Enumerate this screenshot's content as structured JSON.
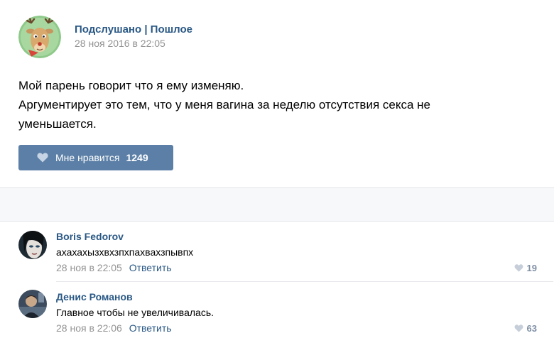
{
  "post": {
    "group_name": "Подслушано | Пошлое",
    "date": "28 ноя 2016 в 22:05",
    "text_lines": [
      "Мой парень говорит что я ему изменяю.",
      "Аргументирует это тем, что у меня вагина за неделю отсутствия секса не",
      "уменьшается."
    ],
    "like_label": "Мне нравится",
    "like_count": "1249"
  },
  "comments": [
    {
      "author": "Boris Fedorov",
      "text": "ахахахызхвхзпхпахвахзпывпх",
      "date": "28 ноя в 22:05",
      "reply": "Ответить",
      "likes": "19"
    },
    {
      "author": "Денис Романов",
      "text": "Главное чтобы не увеличивалась.",
      "date": "28 ноя в 22:06",
      "reply": "Ответить",
      "likes": "63"
    }
  ],
  "colors": {
    "link": "#2a5885",
    "like_button": "#5b7fa6",
    "muted": "#939393"
  },
  "icons": {
    "post_like": "heart-icon",
    "comment_like": "heart-icon"
  }
}
